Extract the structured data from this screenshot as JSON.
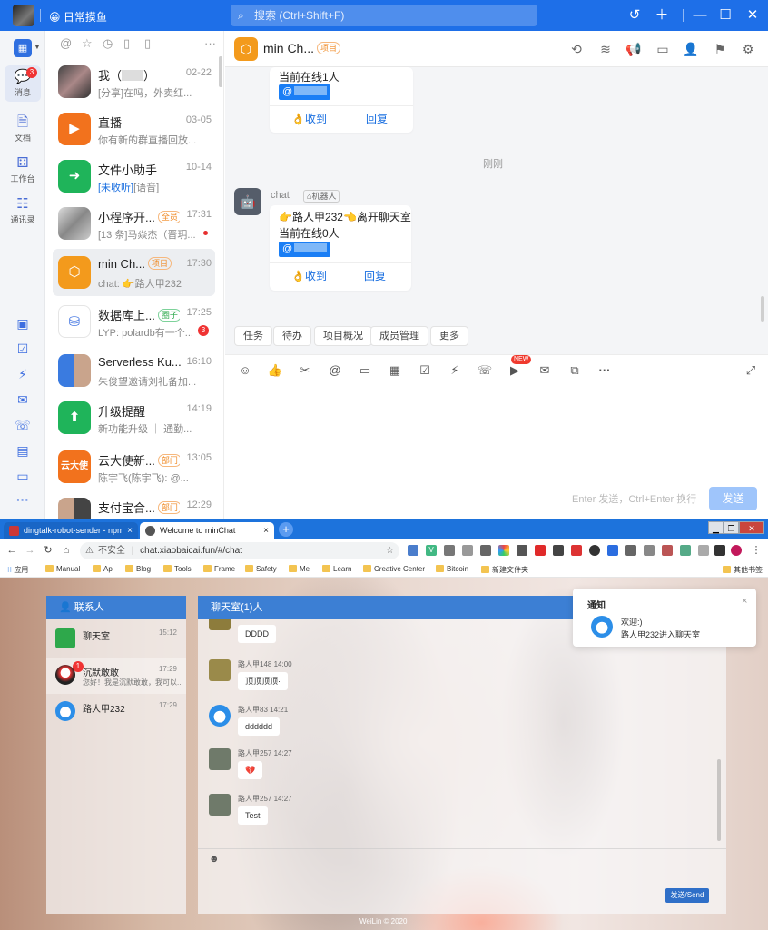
{
  "dingtalk": {
    "status_label": "日常摸鱼",
    "search_placeholder": "搜索 (Ctrl+Shift+F)",
    "rail": {
      "messages": "消息",
      "messages_badge": "3",
      "docs": "文档",
      "workbench": "工作台",
      "contacts": "通讯录",
      "more": "···"
    },
    "conversations": [
      {
        "name": "我（",
        "name_tail": "）",
        "time": "02-22",
        "preview": "[分享]在吗，外卖红...",
        "tag": ""
      },
      {
        "name": "直播",
        "time": "03-05",
        "preview": "你有新的群直播回放...",
        "tag": ""
      },
      {
        "name": "文件小助手",
        "time": "10-14",
        "preview": "[未收听][语音]",
        "preview_highlight": "[未收听]",
        "preview_rest": "[语音]",
        "tag": ""
      },
      {
        "name": "小程序开...",
        "time": "17:31",
        "preview": "[13 条]马焱杰（晋玥...",
        "tag": "全员"
      },
      {
        "name": "min Ch...",
        "time": "17:30",
        "preview": "chat: 👉路人甲232",
        "tag": "项目"
      },
      {
        "name": "数据库上...",
        "time": "17:25",
        "preview": "LYP: polardb有一个...",
        "tag": "圈子",
        "badge": "3"
      },
      {
        "name": "Serverless Ku...",
        "time": "16:10",
        "preview": "朱俊望邀请刘礼备加...",
        "tag": ""
      },
      {
        "name": "升级提醒",
        "time": "14:19",
        "preview": "新功能升级 ｜ 通勤...",
        "tag": ""
      },
      {
        "name": "云大使新...",
        "time": "13:05",
        "preview": "陈宇飞(陈宇飞): @...",
        "tag": "部门",
        "avatar_text": "云大使"
      },
      {
        "name": "支付宝合...",
        "time": "12:29",
        "preview": "",
        "tag": "部门"
      }
    ],
    "chat": {
      "title": "min Ch...",
      "title_tag": "项目",
      "card1": {
        "line": "当前在线1人",
        "mention": "@",
        "ack": "收到",
        "reply": "回复"
      },
      "time_separator": "刚刚",
      "bot_name": "chat",
      "bot_tag": "机器人",
      "card2": {
        "line1": "👉路人甲232👈离开聊天室",
        "line2": "当前在线0人",
        "mention": "@",
        "ack": "收到",
        "reply": "回复"
      },
      "quick_actions": [
        "任务",
        "待办",
        "项目概况",
        "成员管理",
        "更多"
      ],
      "new_badge": "NEW",
      "input_hint": "Enter 发送，Ctrl+Enter 换行",
      "send_label": "发送"
    }
  },
  "chrome": {
    "tabs": [
      {
        "title": "dingtalk-robot-sender - npm",
        "close": "×"
      },
      {
        "title": "Welcome to minChat",
        "close": "×"
      }
    ],
    "new_tab": "+",
    "insecure_label": "不安全",
    "url": "chat.xiaobaicai.fun/#/chat",
    "bookmarks": [
      "应用",
      "Manual",
      "Api",
      "Blog",
      "Tools",
      "Frame",
      "Safety",
      "Me",
      "Learn",
      "Creative Center",
      "Bitcoin",
      "新建文件夹"
    ],
    "other_bookmarks": "其他书签"
  },
  "minchat": {
    "contacts_title": "联系人",
    "contacts": [
      {
        "name": "聊天室",
        "time": "15:12",
        "msg": ""
      },
      {
        "name": "沉默敢敢",
        "time": "17:29",
        "msg": "您好！我是沉默敢敢，我可以...",
        "badge": "1"
      },
      {
        "name": "路人甲232",
        "time": "17:29",
        "msg": ""
      }
    ],
    "room_title": "聊天室(1)人",
    "messages": [
      {
        "name": "",
        "text": "DDDD"
      },
      {
        "name": "路人甲148 14:00",
        "text": "顶顶顶顶·"
      },
      {
        "name": "路人甲83 14:21",
        "text": "dddddd"
      },
      {
        "name": "路人甲257 14:27",
        "text": "💔"
      },
      {
        "name": "路人甲257 14:27",
        "text": "Test"
      }
    ],
    "send_label": "发送/Send",
    "notify": {
      "title": "通知",
      "line1": "欢迎:)",
      "line2": "路人甲232进入聊天室",
      "close": "×"
    },
    "footer": "WeiLin © 2020"
  }
}
